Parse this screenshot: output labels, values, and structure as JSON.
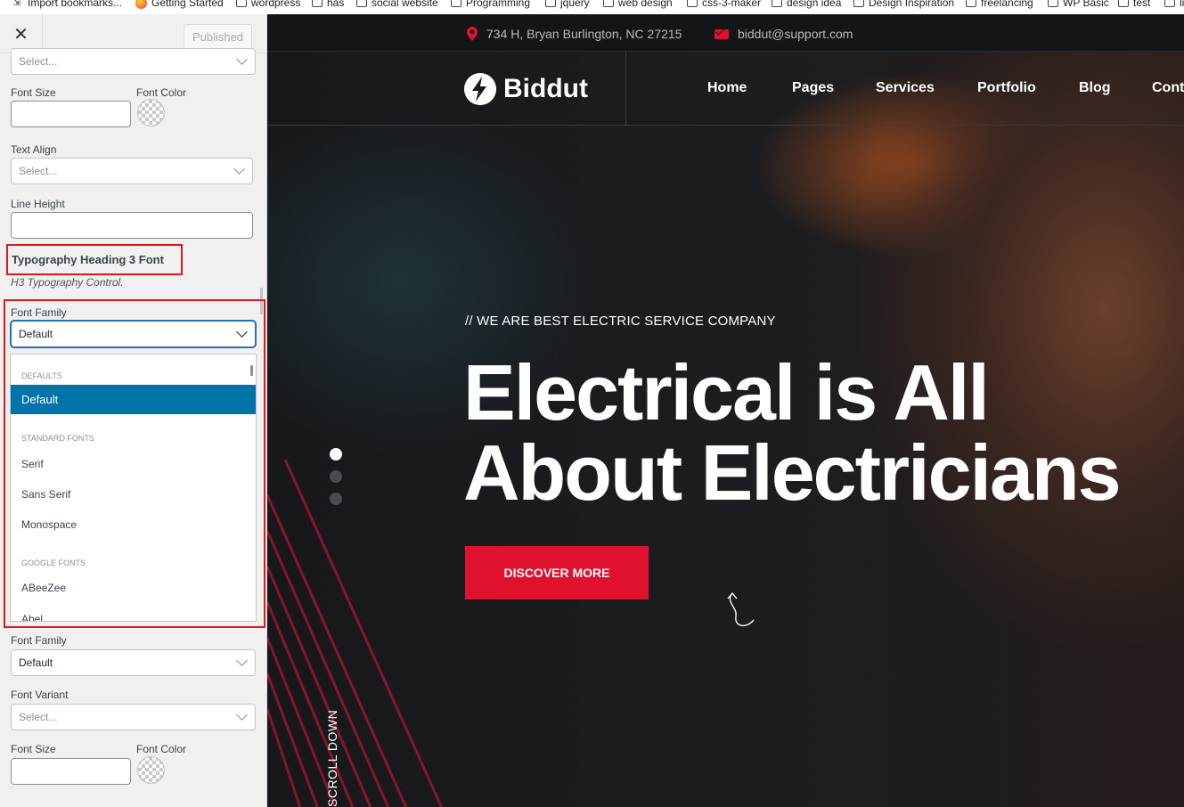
{
  "bookmarks": [
    {
      "label": "Import bookmarks...",
      "icon": "import-icon"
    },
    {
      "label": "Getting Started",
      "icon": "firefox-icon"
    },
    {
      "label": "wordpress",
      "icon": "folder-icon"
    },
    {
      "label": "has",
      "icon": "folder-icon"
    },
    {
      "label": "social website",
      "icon": "folder-icon"
    },
    {
      "label": "Programming",
      "icon": "folder-icon"
    },
    {
      "label": "jquery",
      "icon": "folder-icon"
    },
    {
      "label": "web design",
      "icon": "folder-icon"
    },
    {
      "label": "css-3-maker",
      "icon": "folder-icon"
    },
    {
      "label": "design idea",
      "icon": "folder-icon"
    },
    {
      "label": "Design Inspiration",
      "icon": "folder-icon"
    },
    {
      "label": "freelancing",
      "icon": "folder-icon"
    },
    {
      "label": "WP Basic",
      "icon": "folder-icon"
    },
    {
      "label": "test",
      "icon": "folder-icon"
    },
    {
      "label": "li",
      "icon": "folder-icon"
    }
  ],
  "customizer": {
    "close_label": "✕",
    "publish_label": "Published",
    "top_select": {
      "value": "Select..."
    },
    "font_size_label": "Font Size",
    "font_color_label": "Font Color",
    "text_align_label": "Text Align",
    "text_align_value": "Select...",
    "line_height_label": "Line Height",
    "section_title": "Typography Heading 3 Font",
    "section_desc": "H3 Typography Control.",
    "font_family_label": "Font Family",
    "font_family_value": "Default",
    "dropdown": {
      "groups": [
        {
          "name": "DEFAULTS",
          "options": [
            "Default"
          ]
        },
        {
          "name": "STANDARD FONTS",
          "options": [
            "Serif",
            "Sans Serif",
            "Monospace"
          ]
        },
        {
          "name": "GOOGLE FONTS",
          "options": [
            "ABeeZee",
            "Abel"
          ]
        }
      ],
      "selected": "Default"
    },
    "font_family2_label": "Font Family",
    "font_family2_value": "Default",
    "font_variant_label": "Font Variant",
    "font_variant_value": "Select...",
    "font_size2_label": "Font Size",
    "font_color2_label": "Font Color"
  },
  "preview": {
    "address": "734 H, Bryan Burlington, NC 27215",
    "email": "biddut@support.com",
    "logo_text": "Biddut",
    "nav": [
      "Home",
      "Pages",
      "Services",
      "Portfolio",
      "Blog",
      "Cont"
    ],
    "tagline": "// WE ARE BEST ELECTRIC SERVICE COMPANY",
    "title_line1": "Electrical is All",
    "title_line2": "About Electricians",
    "cta_label": "DISCOVER MORE",
    "scroll_label": "SCROLL DOWN",
    "accent_color": "#e0102f"
  }
}
